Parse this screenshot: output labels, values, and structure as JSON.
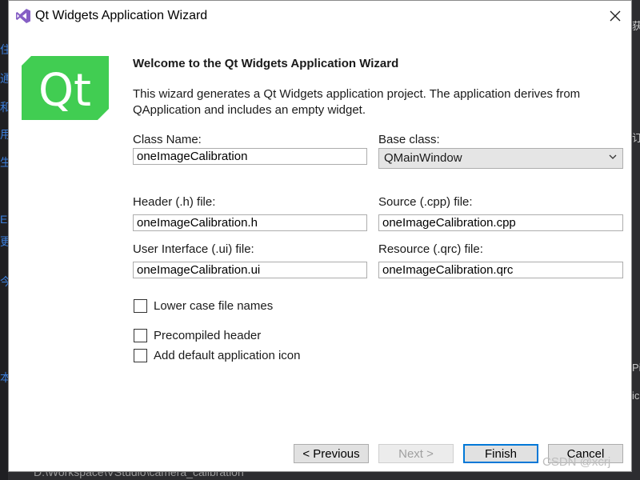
{
  "dialog": {
    "title": "Qt Widgets Application Wizard",
    "heading": "Welcome to the Qt Widgets Application Wizard",
    "description": "This wizard generates a Qt Widgets application project. The application derives from QApplication and includes an empty widget.",
    "logo_text": "Qt",
    "brand_color": "#41cd52"
  },
  "fields": {
    "class_name": {
      "label": "Class Name:",
      "value": "oneImageCalibration"
    },
    "base_class": {
      "label": "Base class:",
      "value": "QMainWindow"
    },
    "header": {
      "label": "Header (.h) file:",
      "value": "oneImageCalibration.h"
    },
    "source": {
      "label": "Source (.cpp) file:",
      "value": "oneImageCalibration.cpp"
    },
    "ui": {
      "label": "User Interface (.ui) file:",
      "value": "oneImageCalibration.ui"
    },
    "resource": {
      "label": "Resource (.qrc) file:",
      "value": "oneImageCalibration.qrc"
    }
  },
  "options": {
    "lower_case": {
      "label": "Lower case file names",
      "checked": false
    },
    "precompiled": {
      "label": "Precompiled header",
      "checked": false
    },
    "default_icon": {
      "label": "Add default application icon",
      "checked": false
    }
  },
  "buttons": {
    "previous": "< Previous",
    "next": "Next >",
    "finish": "Finish",
    "cancel": "Cancel"
  },
  "background": {
    "left_glyphs": [
      "住",
      "通",
      "和",
      "用",
      "生",
      "E",
      "更",
      "今",
      "本"
    ],
    "right_glyphs": [
      "获",
      "订",
      "Pi",
      "ic"
    ],
    "path_text": "D:\\Workspace\\VStudio\\camera_calibration",
    "watermark": "CSDN @xcrj"
  }
}
